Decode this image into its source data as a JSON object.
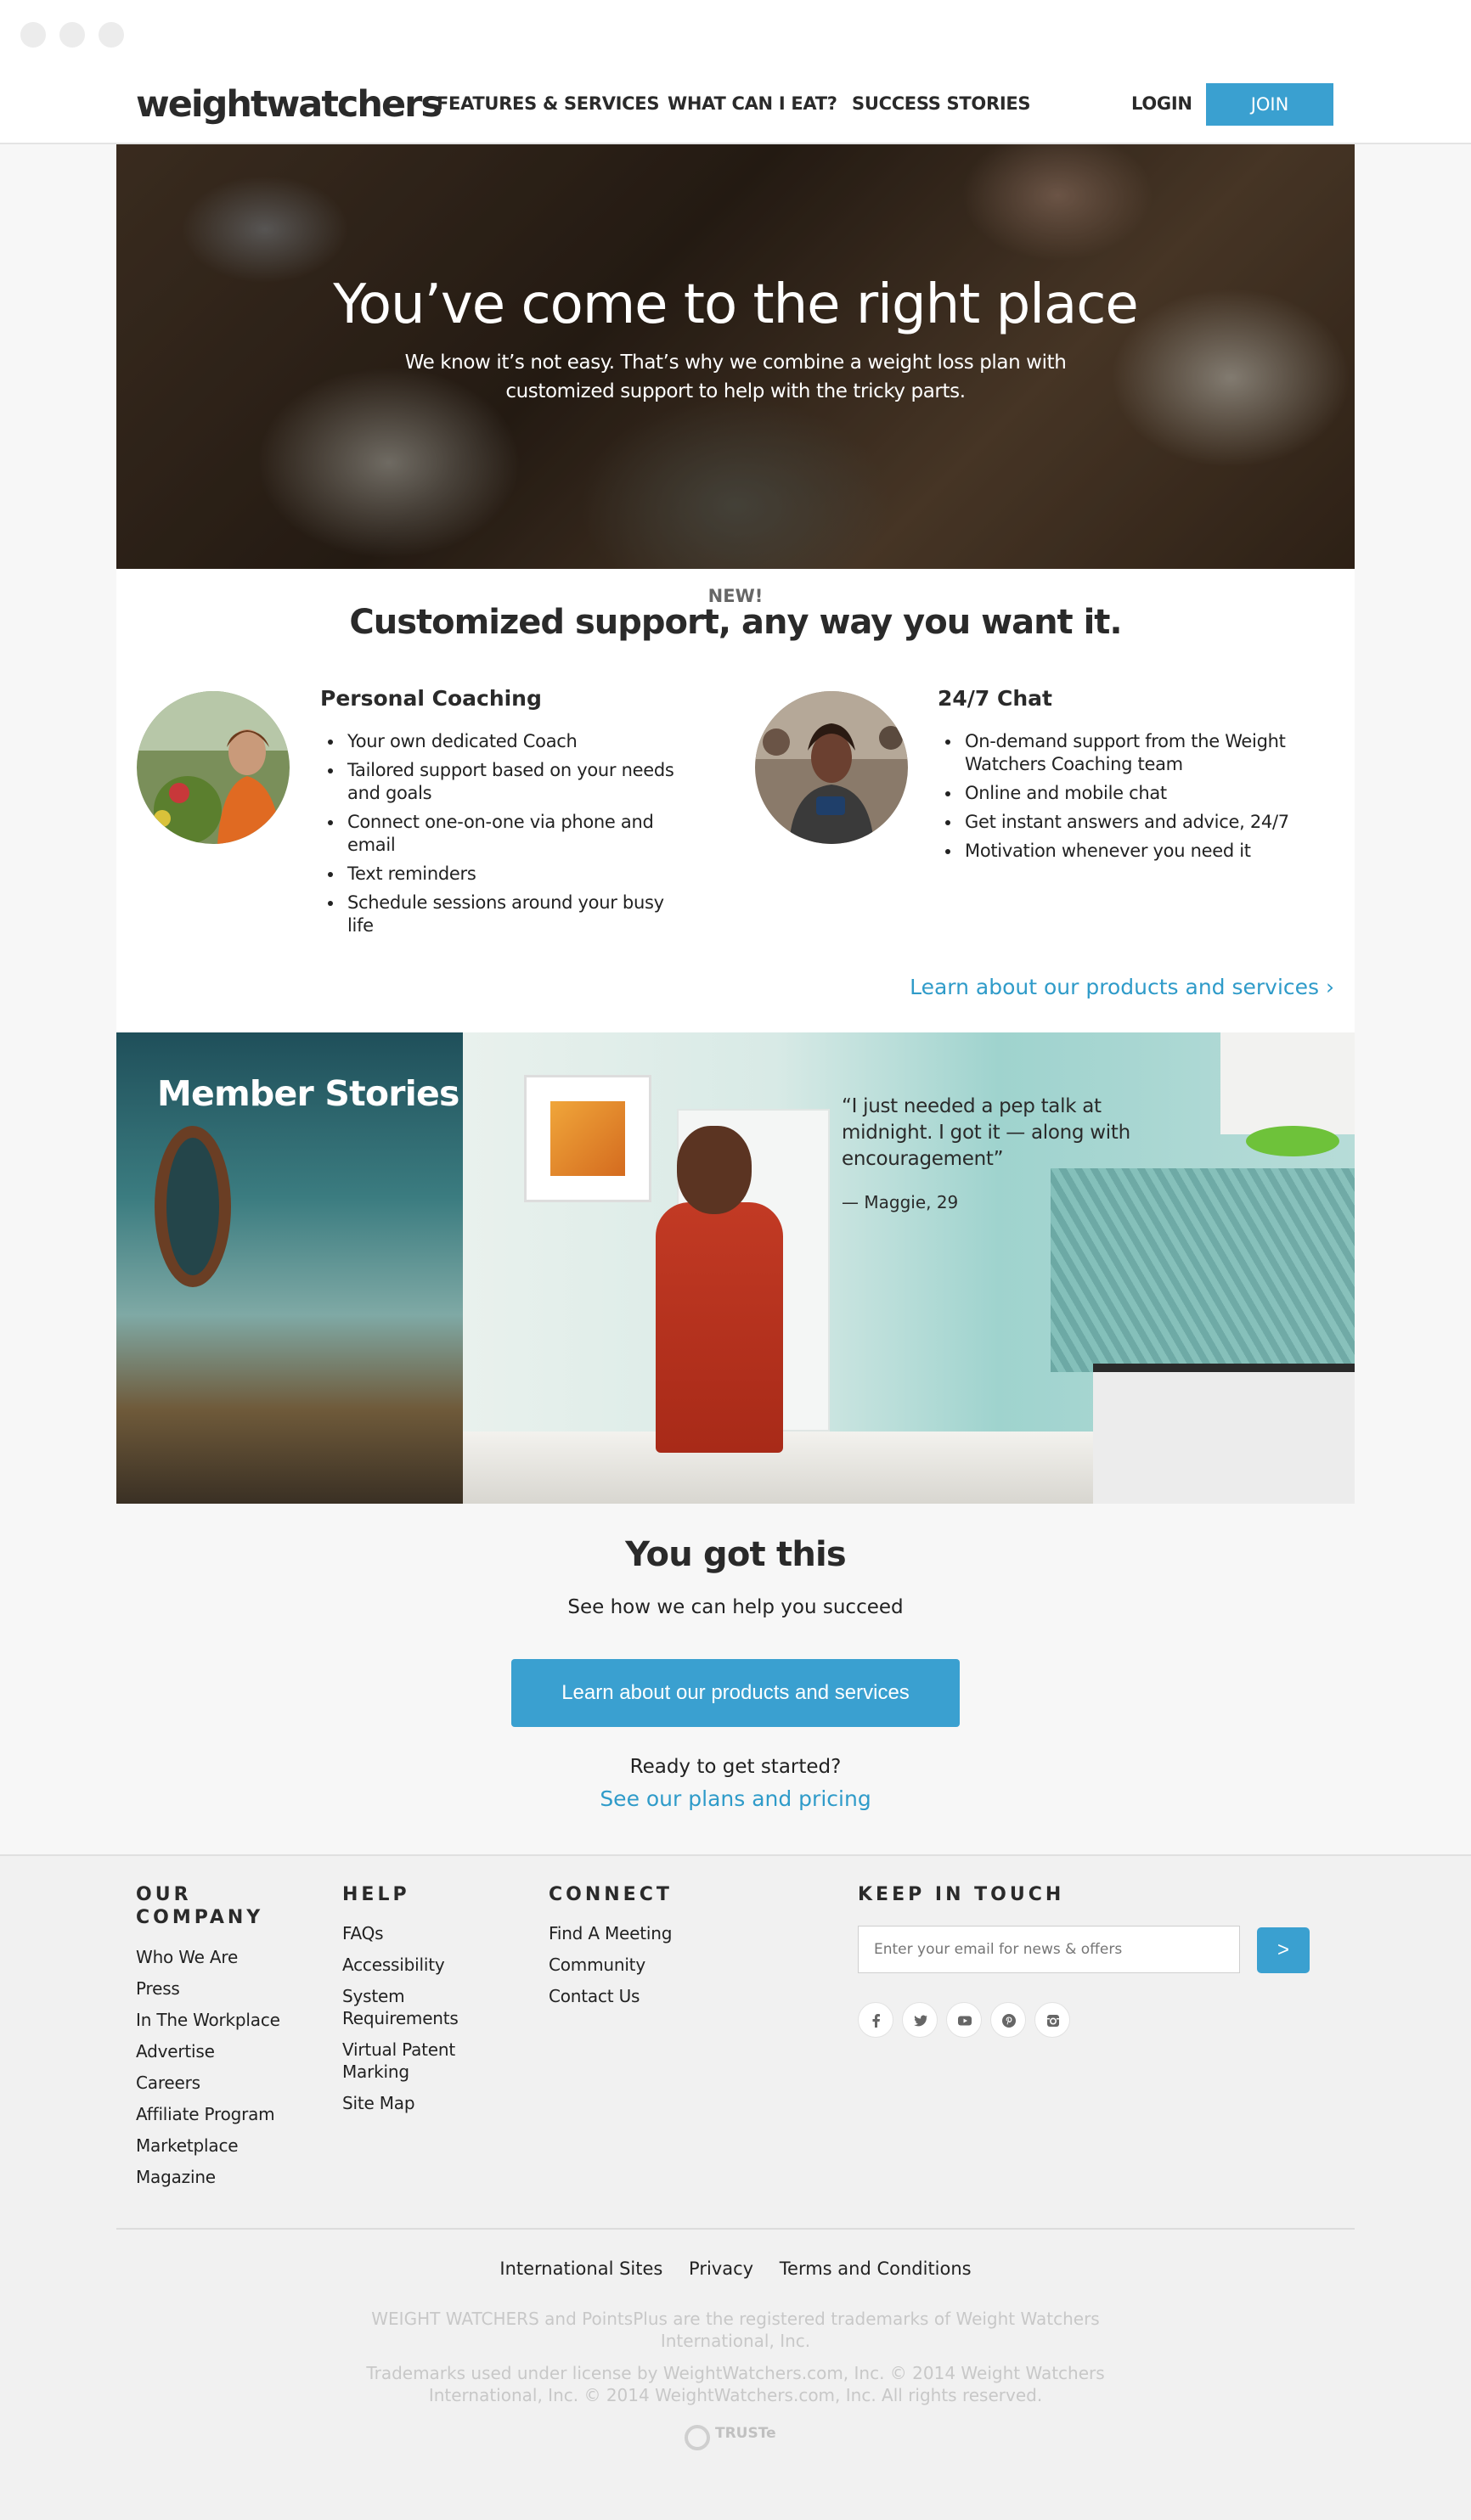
{
  "header": {
    "logo": "weightwatchers",
    "nav": [
      "FEATURES & SERVICES",
      "WHAT CAN I EAT?",
      "SUCCESS STORIES"
    ],
    "login": "LOGIN",
    "join": "JOIN"
  },
  "hero": {
    "title": "You’ve come to the right place",
    "subtitle": "We know it’s not easy. That’s why we combine a weight loss plan with customized support to help with the tricky parts."
  },
  "support": {
    "tag": "NEW!",
    "title": "Customized support, any way you want it.",
    "coaching": {
      "title": "Personal Coaching",
      "items": [
        "Your own dedicated Coach",
        "Tailored support based on your needs and goals",
        "Connect one-on-one via phone and email",
        "Text reminders",
        "Schedule sessions around your busy life"
      ]
    },
    "chat": {
      "title": "24/7 Chat",
      "items": [
        "On-demand support from the Weight Watchers Coaching team",
        "Online and mobile chat",
        "Get instant answers and advice, 24/7",
        "Motivation whenever you need it"
      ]
    },
    "link": "Learn about our products and services ›"
  },
  "stories": {
    "title": "Member Stories",
    "quote": "“I just needed a pep talk at midnight. I got it — along with encouragement”",
    "author": "— Maggie, 29"
  },
  "cta": {
    "title": "You got this",
    "subtitle": "See how we can help you succeed",
    "button": "Learn about our products and services",
    "ready": "Ready to get started?",
    "plans": "See our plans and pricing"
  },
  "footer": {
    "company": {
      "heading": "OUR COMPANY",
      "links": [
        "Who We Are",
        "Press",
        "In The Workplace",
        "Advertise",
        "Careers",
        "Affiliate Program",
        "Marketplace",
        "Magazine"
      ]
    },
    "help": {
      "heading": "HELP",
      "links": [
        "FAQs",
        "Accessibility",
        "System Requirements",
        "Virtual Patent Marking",
        "Site Map"
      ]
    },
    "connect": {
      "heading": "CONNECT",
      "links": [
        "Find A Meeting",
        "Community",
        "Contact Us"
      ]
    },
    "keep": {
      "heading": "KEEP IN TOUCH",
      "placeholder": "Enter your email for news & offers",
      "submit": ">",
      "social_icons": [
        "facebook-icon",
        "twitter-icon",
        "youtube-icon",
        "pinterest-icon",
        "instagram-icon"
      ]
    },
    "bottom_links": [
      "International Sites",
      "Privacy",
      "Terms and Conditions"
    ],
    "legal1": "WEIGHT WATCHERS and PointsPlus are the registered trademarks of Weight Watchers International, Inc.",
    "legal2": "Trademarks used under license by WeightWatchers.com, Inc. © 2014 Weight Watchers International, Inc. © 2014 WeightWatchers.com, Inc. All rights reserved.",
    "truste": "TRUSTe"
  },
  "colors": {
    "accent": "#3aa0d0",
    "link": "#2f9bc9",
    "text": "#2a2a2a"
  }
}
